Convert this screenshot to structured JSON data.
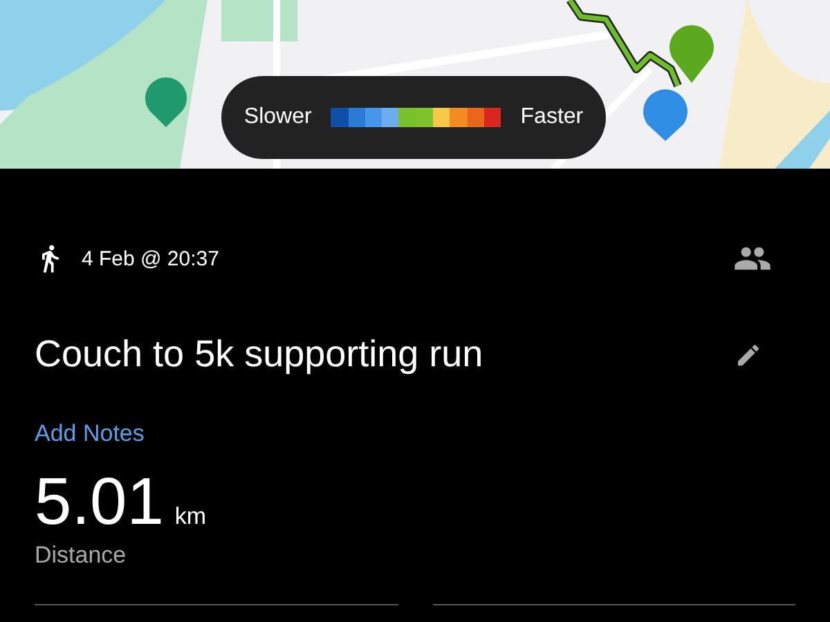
{
  "map": {
    "legend": {
      "low_label": "Slower",
      "high_label": "Faster",
      "swatches": [
        {
          "color": "#0d4fa6"
        },
        {
          "color": "#2a7ad6"
        },
        {
          "color": "#4696ea"
        },
        {
          "color": "#6aaef0"
        },
        {
          "color": "#79c12a"
        },
        {
          "color": "#7dc32c"
        },
        {
          "color": "#f7c94b"
        },
        {
          "color": "#f38b22"
        },
        {
          "color": "#e8651a"
        },
        {
          "color": "#d9261e"
        }
      ]
    }
  },
  "activity": {
    "datetime": "4 Feb @ 20:37",
    "title": "Couch to 5k supporting run",
    "add_notes": "Add Notes",
    "stat": {
      "value": "5.01",
      "unit": "km",
      "label": "Distance"
    }
  }
}
